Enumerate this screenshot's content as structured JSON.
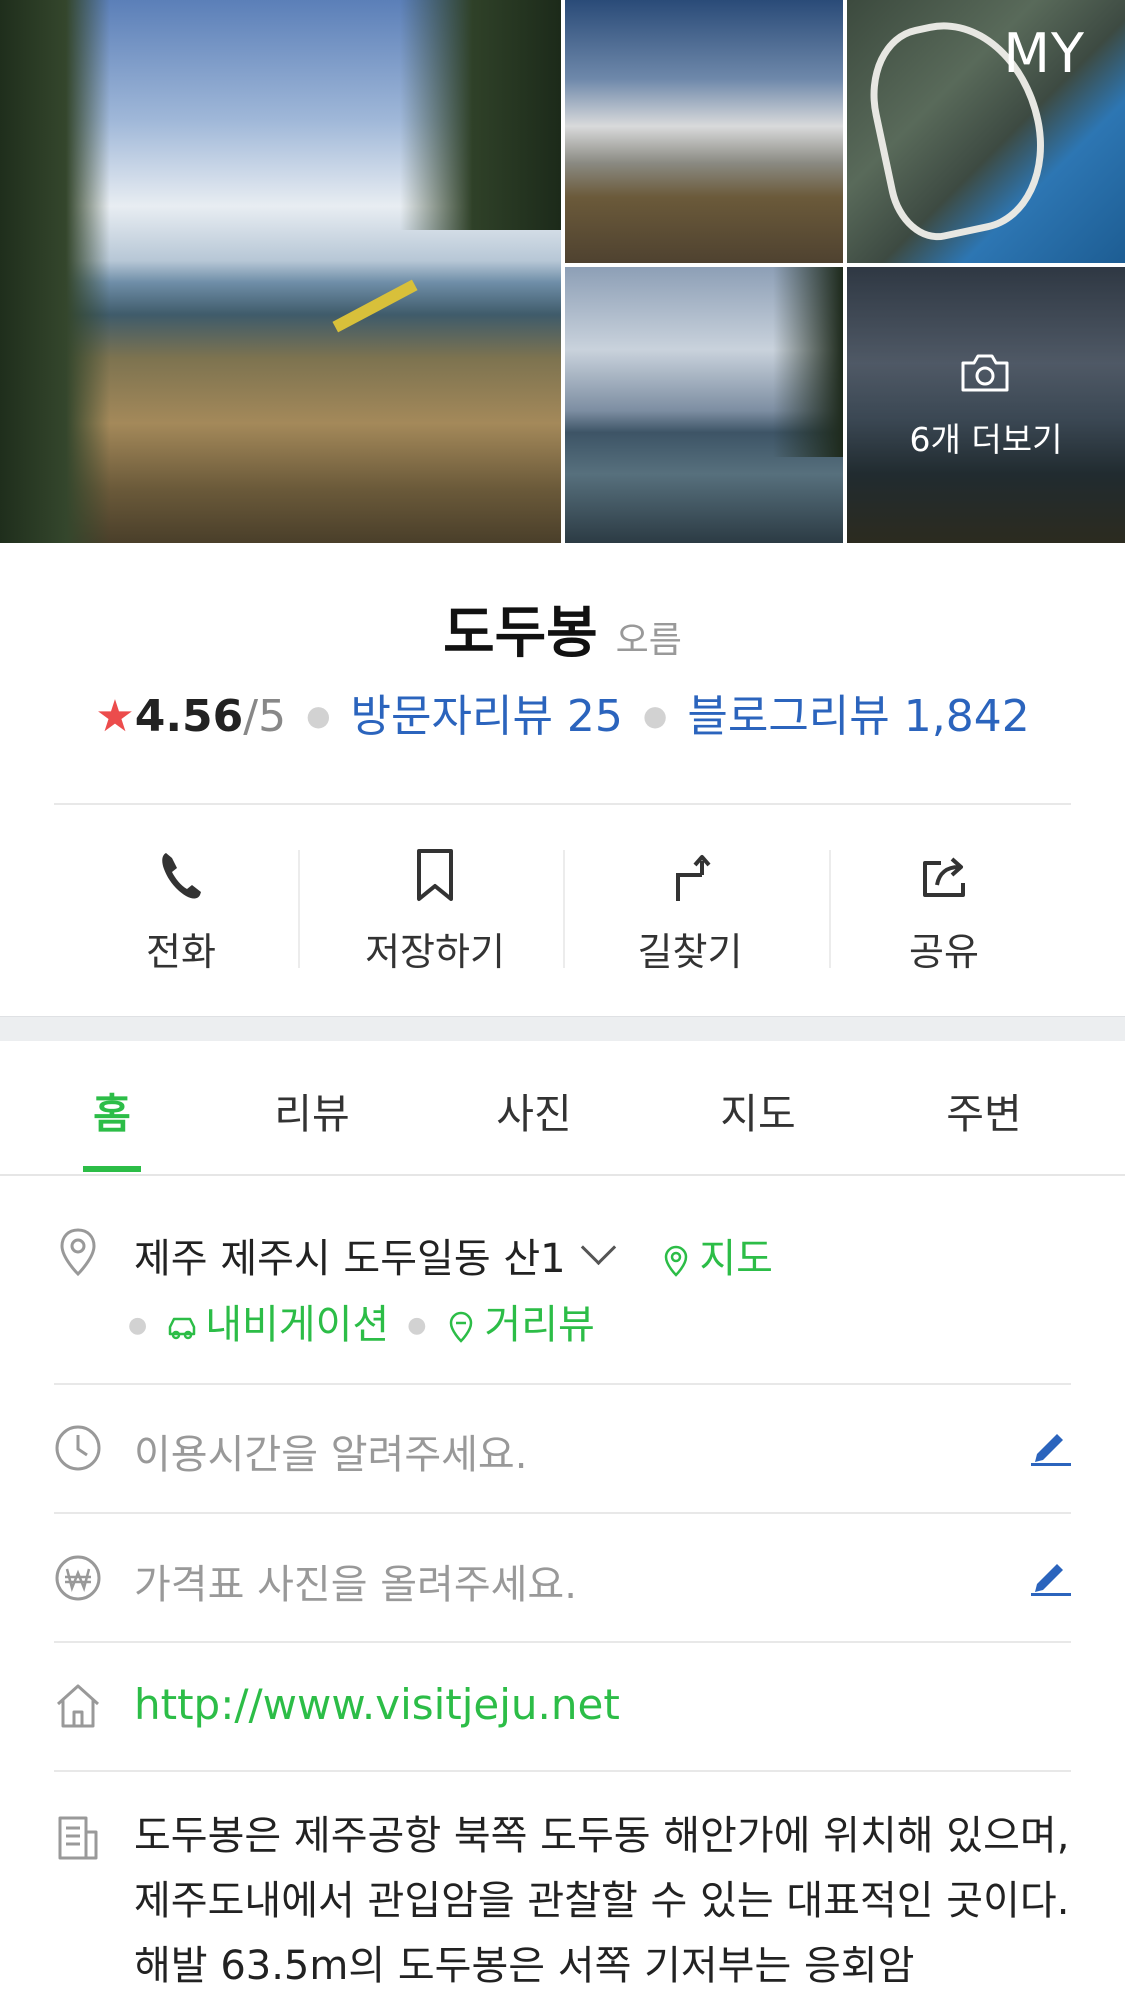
{
  "header": {
    "my_label": "MY",
    "more_photos_label": "6개 더보기"
  },
  "place": {
    "name": "도두봉",
    "category": "오름",
    "rating": "4.56",
    "rating_max": "/5",
    "visitor_reviews": "방문자리뷰 25",
    "blog_reviews": "블로그리뷰 1,842"
  },
  "actions": [
    {
      "label": "전화",
      "icon": "phone-icon"
    },
    {
      "label": "저장하기",
      "icon": "bookmark-icon"
    },
    {
      "label": "길찾기",
      "icon": "directions-icon"
    },
    {
      "label": "공유",
      "icon": "share-icon"
    }
  ],
  "tabs": [
    "홈",
    "리뷰",
    "사진",
    "지도",
    "주변"
  ],
  "active_tab": "홈",
  "info": {
    "address": "제주 제주시 도두일동 산1",
    "map_link": "지도",
    "navigation_link": "내비게이션",
    "streetview_link": "거리뷰",
    "hours_placeholder": "이용시간을 알려주세요.",
    "price_placeholder": "가격표 사진을 올려주세요.",
    "website": "http://www.visitjeju.net",
    "description": "도두봉은 제주공항 북쪽 도두동 해안가에 위치해 있으며, 제주도내에서 관입암을 관찰할 수 있는 대표적인 곳이다. 해발 63.5m의 도두봉은 서쪽 기저부는 응회암"
  },
  "colors": {
    "accent_green": "#2cbd47",
    "link_blue": "#2b64bd",
    "star_red": "#ec4c4c"
  }
}
